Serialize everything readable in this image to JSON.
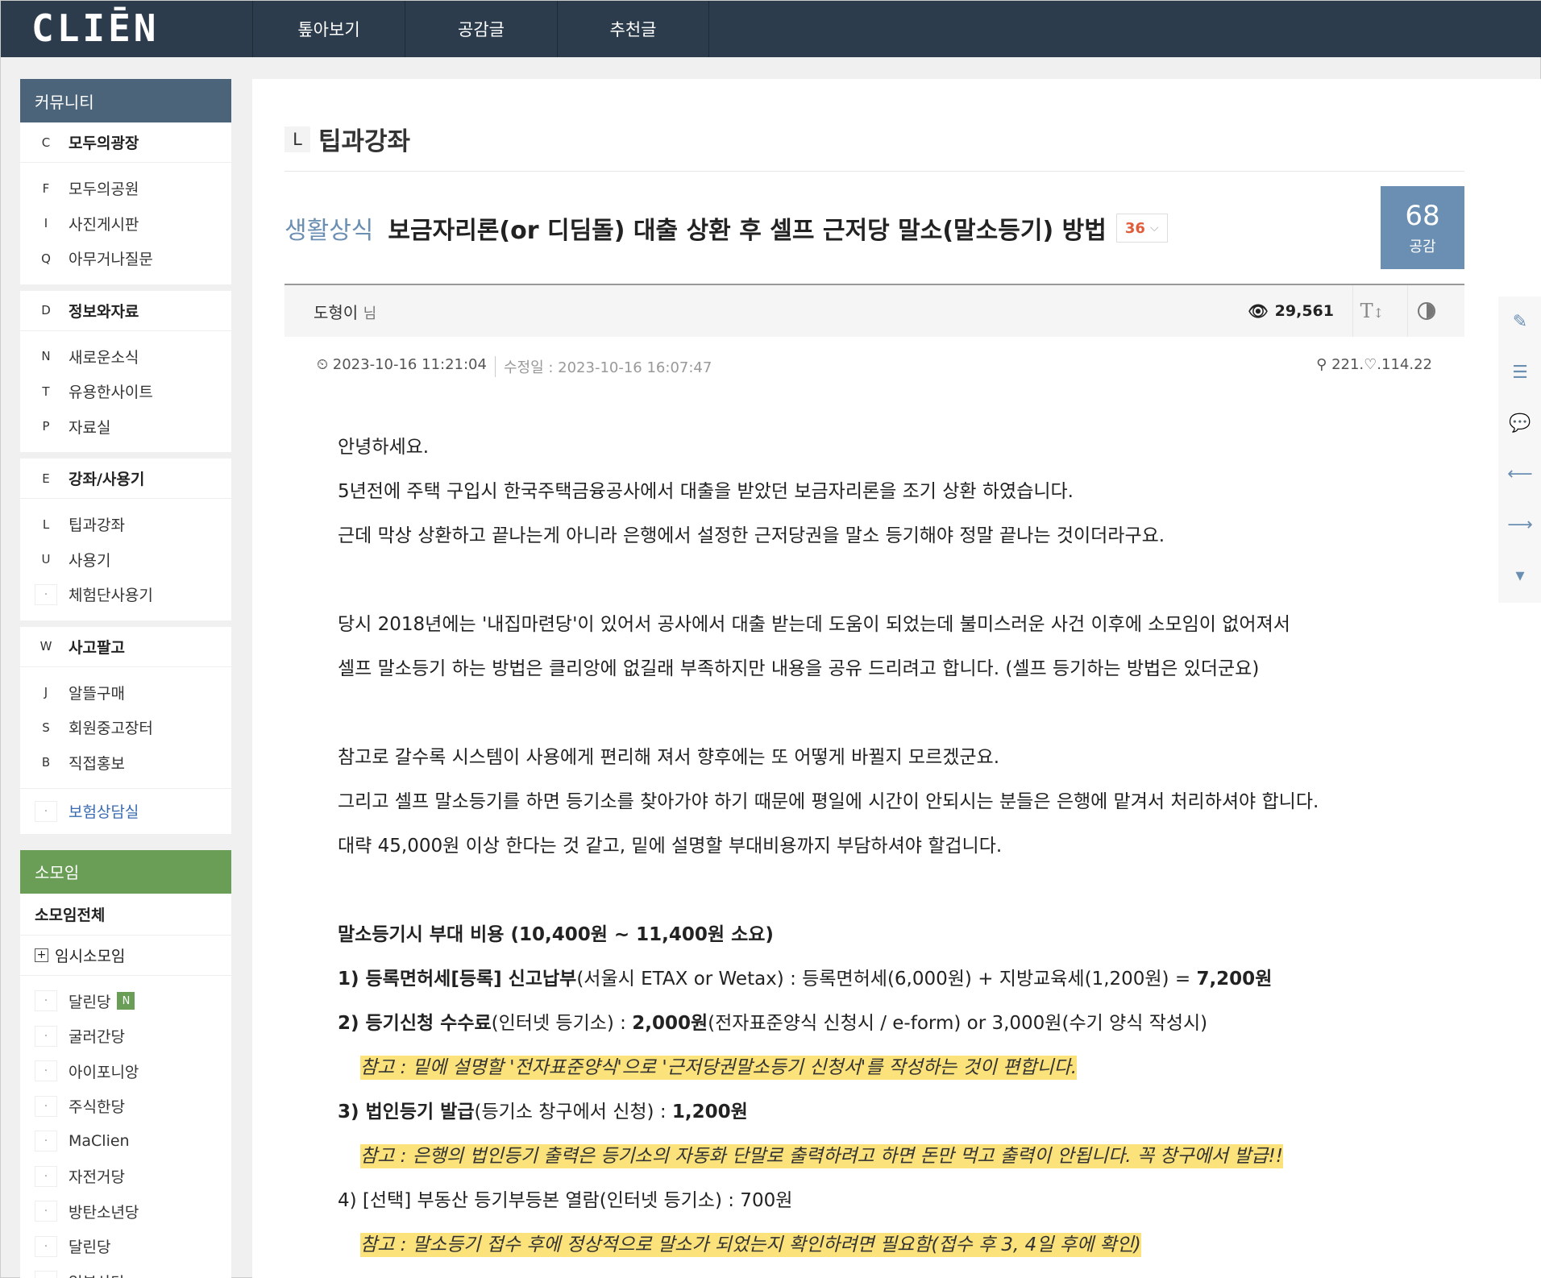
{
  "header": {
    "logo": "CLIĒN",
    "nav": [
      "톺아보기",
      "공감글",
      "추천글"
    ]
  },
  "sidebar": {
    "community_title": "커뮤니티",
    "groups": [
      {
        "letter": "C",
        "label": "모두의광장",
        "items": [
          {
            "letter": "F",
            "label": "모두의공원"
          },
          {
            "letter": "I",
            "label": "사진게시판"
          },
          {
            "letter": "Q",
            "label": "아무거나질문"
          }
        ]
      },
      {
        "letter": "D",
        "label": "정보와자료",
        "items": [
          {
            "letter": "N",
            "label": "새로운소식"
          },
          {
            "letter": "T",
            "label": "유용한사이트"
          },
          {
            "letter": "P",
            "label": "자료실"
          }
        ]
      },
      {
        "letter": "E",
        "label": "강좌/사용기",
        "items": [
          {
            "letter": "L",
            "label": "팁과강좌"
          },
          {
            "letter": "U",
            "label": "사용기"
          },
          {
            "letter": "·",
            "label": "체험단사용기"
          }
        ]
      },
      {
        "letter": "W",
        "label": "사고팔고",
        "items": [
          {
            "letter": "J",
            "label": "알뜰구매"
          },
          {
            "letter": "S",
            "label": "회원중고장터"
          },
          {
            "letter": "B",
            "label": "직접홍보"
          }
        ]
      }
    ],
    "insurance": "보험상담실",
    "somoim_title": "소모임",
    "somoim_all": "소모임전체",
    "somoim_temp": "임시소모임",
    "badge_new": "N",
    "somoim_items": [
      "달린당",
      "굴러간당",
      "아이포니앙",
      "주식한당",
      "MaClien",
      "자전거당",
      "방탄소년당",
      "달린당",
      "일본산당"
    ]
  },
  "board": {
    "letter": "L",
    "title": "팁과강좌"
  },
  "post": {
    "category": "생활상식",
    "title": "보금자리론(or 디딤돌) 대출 상환 후 셀프 근저당 말소(말소등기) 방법",
    "comment_count": "36",
    "likes": "68",
    "likes_label": "공감",
    "author": "도형이",
    "author_suffix": "님",
    "views": "29,561",
    "font_tool": "T",
    "date": "2023-10-16 11:21:04",
    "modified": "수정일 : 2023-10-16 16:07:47",
    "ip": "221.♡.114.22"
  },
  "content": {
    "l1": "안녕하세요.",
    "l2": "5년전에 주택 구입시 한국주택금융공사에서 대출을 받았던 보금자리론을 조기 상환 하였습니다.",
    "l3": "근데 막상 상환하고 끝나는게 아니라 은행에서 설정한 근저당권을 말소 등기해야 정말 끝나는 것이더라구요.",
    "l4": "당시 2018년에는 '내집마련당'이 있어서 공사에서 대출 받는데 도움이 되었는데 불미스러운 사건 이후에 소모임이 없어져서",
    "l5": "셀프 말소등기 하는 방법은 클리앙에 없길래 부족하지만 내용을 공유 드리려고 합니다. (셀프 등기하는 방법은 있더군요)",
    "l6": "참고로 갈수록 시스템이 사용에게 편리해 져서 향후에는 또 어떻게 바뀔지 모르겠군요.",
    "l7": "그리고 셀프 말소등기를 하면 등기소를 찾아가야 하기 때문에 평일에 시간이 안되시는 분들은 은행에 맡겨서 처리하셔야 합니다.",
    "l8": "대략 45,000원 이상 한다는 것 같고, 밑에 설명할 부대비용까지 부담하셔야 할겁니다.",
    "cost_title": "말소등기시 부대 비용 (10,400원 ~ 11,400원 소요)",
    "i1_bold": "1) 등록면허세[등록] 신고납부",
    "i1_rest": "(서울시 ETAX or Wetax) : 등록면허세(6,000원) + 지방교육세(1,200원) = ",
    "i1_total": "7,200원",
    "i2_bold": "2) 등기신청 수수료",
    "i2_mid": "(인터넷 등기소) : ",
    "i2_amt": "2,000원",
    "i2_rest": "(전자표준양식 신청시 / e-form) or 3,000원(수기 양식 작성시)",
    "n2": "참고 : 밑에 설명할 '전자표준양식'으로 '근저당권말소등기 신청서'를 작성하는 것이 편합니다.",
    "i3_bold": "3) 법인등기 발급",
    "i3_mid": "(등기소 창구에서 신청) : ",
    "i3_amt": "1,200원",
    "n3": "참고 : 은행의 법인등기 출력은 등기소의 자동화 단말로 출력하려고 하면 돈만 먹고 출력이 안됩니다. 꼭 창구에서 발급!!",
    "i4": "4) [선택] 부동산 등기부등본 열람(인터넷 등기소) : 700원",
    "n4": "참고 : 말소등기 접수 후에 정상적으로 말소가 되었는지 확인하려면 필요함(접수 후 3, 4일 후에 확인)"
  }
}
